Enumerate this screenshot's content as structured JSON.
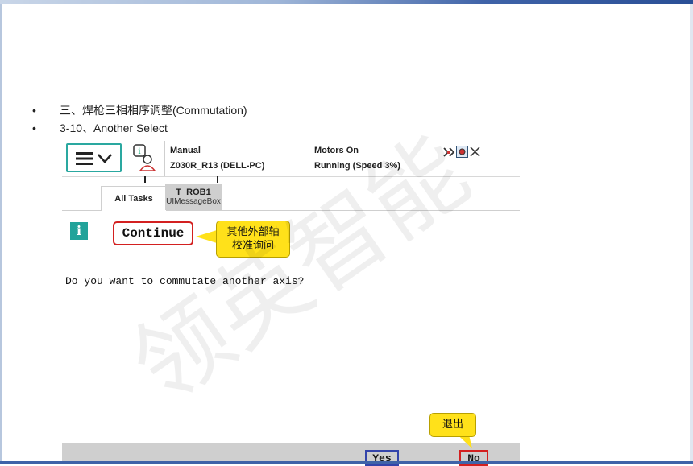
{
  "slide": {
    "bullets": [
      {
        "marker": "•",
        "text": "三、焊枪三相相序调整(Commutation)"
      },
      {
        "marker": "•",
        "text": "3-10、Another Select"
      }
    ]
  },
  "flexpendant": {
    "header": {
      "mode": "Manual",
      "controller": "Z030R_R13 (DELL-PC)",
      "motors": "Motors On",
      "running": "Running (Speed 3%)"
    },
    "tabs": [
      {
        "label": "All Tasks"
      },
      {
        "label": "T_ROB1",
        "sublabel": "UIMessageBox"
      }
    ],
    "message": {
      "title": "Continue",
      "body": "Do you want to commutate another axis?"
    },
    "buttons": {
      "yes": "Yes",
      "no": "No"
    },
    "colors": {
      "accent": "#2aa8a0",
      "highlight_red": "#d32020",
      "highlight_blue": "#3344aa"
    }
  },
  "callouts": {
    "title_note": [
      "其他外部轴",
      "校准询问"
    ],
    "exit_note": "退出"
  },
  "watermark": "领英智能"
}
